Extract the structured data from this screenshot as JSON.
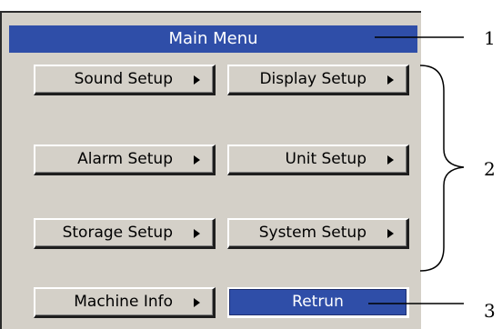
{
  "title": "Main Menu",
  "buttons": {
    "sound": "Sound Setup",
    "display": "Display Setup",
    "alarm": "Alarm Setup",
    "unit": "Unit Setup",
    "storage": "Storage Setup",
    "system": "System Setup",
    "machine": "Machine Info",
    "return": "Retrun"
  },
  "callouts": {
    "c1": "1",
    "c2": "2",
    "c3": "3"
  },
  "colors": {
    "title_bg": "#2f4ea8",
    "panel_bg": "#d4d0c8",
    "selected_bg": "#2f4ea8"
  },
  "icons": {
    "submenu": "triangle-right-icon"
  }
}
